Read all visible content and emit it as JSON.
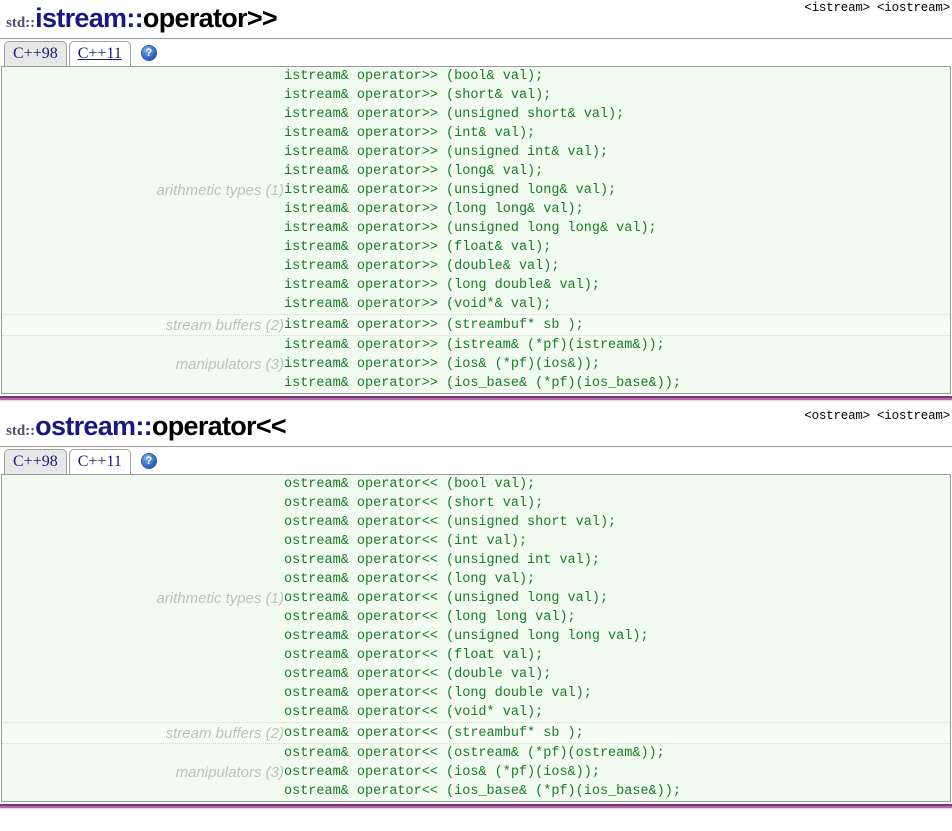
{
  "sections": [
    {
      "title": {
        "namespace": "std::",
        "class": "istream",
        "separator": "::",
        "member": "operator>>"
      },
      "header_links": [
        "<istream>",
        "<iostream>"
      ],
      "tabs": [
        {
          "label": "C++98",
          "active": false,
          "hovered": false
        },
        {
          "label": "C++11",
          "active": true,
          "hovered": true
        }
      ],
      "help_icon": {
        "name": "help-icon",
        "glyph": "?"
      },
      "groups": [
        {
          "label": "arithmetic types (1)",
          "signatures": [
            "istream& operator>> (bool& val);",
            "istream& operator>> (short& val);",
            "istream& operator>> (unsigned short& val);",
            "istream& operator>> (int& val);",
            "istream& operator>> (unsigned int& val);",
            "istream& operator>> (long& val);",
            "istream& operator>> (unsigned long& val);",
            "istream& operator>> (long long& val);",
            "istream& operator>> (unsigned long long& val);",
            "istream& operator>> (float& val);",
            "istream& operator>> (double& val);",
            "istream& operator>> (long double& val);",
            "istream& operator>> (void*& val);"
          ]
        },
        {
          "label": "stream buffers (2)",
          "signatures": [
            "istream& operator>> (streambuf* sb );"
          ]
        },
        {
          "label": "manipulators (3)",
          "signatures": [
            "istream& operator>> (istream& (*pf)(istream&));",
            "istream& operator>> (ios& (*pf)(ios&));",
            "istream& operator>> (ios_base& (*pf)(ios_base&));"
          ]
        }
      ]
    },
    {
      "title": {
        "namespace": "std::",
        "class": "ostream",
        "separator": "::",
        "member": "operator<<"
      },
      "header_links": [
        "<ostream>",
        "<iostream>"
      ],
      "tabs": [
        {
          "label": "C++98",
          "active": false,
          "hovered": false
        },
        {
          "label": "C++11",
          "active": true,
          "hovered": false
        }
      ],
      "help_icon": {
        "name": "help-icon",
        "glyph": "?"
      },
      "groups": [
        {
          "label": "arithmetic types (1)",
          "signatures": [
            "ostream& operator<< (bool val);",
            "ostream& operator<< (short val);",
            "ostream& operator<< (unsigned short val);",
            "ostream& operator<< (int val);",
            "ostream& operator<< (unsigned int val);",
            "ostream& operator<< (long val);",
            "ostream& operator<< (unsigned long val);",
            "ostream& operator<< (long long val);",
            "ostream& operator<< (unsigned long long val);",
            "ostream& operator<< (float val);",
            "ostream& operator<< (double val);",
            "ostream& operator<< (long double val);",
            "ostream& operator<< (void* val);"
          ]
        },
        {
          "label": "stream buffers (2)",
          "signatures": [
            "ostream& operator<< (streambuf* sb );"
          ]
        },
        {
          "label": "manipulators (3)",
          "signatures": [
            "ostream& operator<< (ostream& (*pf)(ostream&));",
            "ostream& operator<< (ios& (*pf)(ios&));",
            "ostream& operator<< (ios_base& (*pf)(ios_base&));"
          ]
        }
      ]
    }
  ],
  "colors": {
    "title_class": "#1a1a7a",
    "code_text": "#1a7a2a",
    "code_bg": "#f2fbf0",
    "group_label": "#b9c4b6",
    "divider": "#7d3475",
    "tab_text": "#1a1a7a"
  }
}
